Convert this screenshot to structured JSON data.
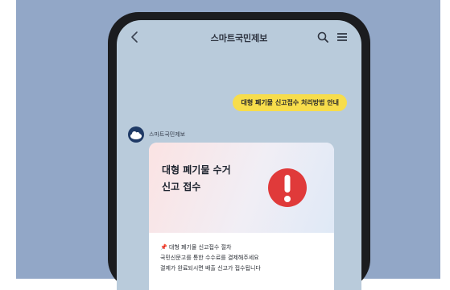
{
  "chat": {
    "title": "스마트국민제보",
    "back_icon": "chevron-left-icon",
    "search_icon": "search-icon",
    "menu_icon": "hamburger-menu-icon"
  },
  "message_out": {
    "text": "대형 폐기물 신고접수 처리방법 안내"
  },
  "bot": {
    "name": "스마트국민제보"
  },
  "card": {
    "title_line1": "대형 폐기물 수거",
    "title_line2": "신고 접수",
    "alert_icon": "exclamation-alert-icon",
    "body_lines": [
      "📌 대형 폐기물 신고접수 절차",
      "국민신문고를 통한 수수료를 결제해주세요",
      "결제가 완료되시면 배출 신고가 접수됩니다"
    ]
  },
  "colors": {
    "background": "#92a7c7",
    "screen": "#b9cbdb",
    "outgoing_bubble": "#f7dd4b",
    "alert_red": "#e03a3a"
  }
}
